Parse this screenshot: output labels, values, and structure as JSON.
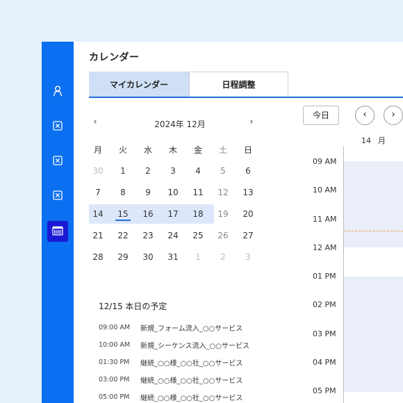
{
  "app": {
    "title": "カレンダー"
  },
  "sidebar": {
    "items": [
      {
        "name": "person-icon"
      },
      {
        "name": "close-box-icon"
      },
      {
        "name": "close-box-icon"
      },
      {
        "name": "close-box-icon"
      },
      {
        "name": "calendar-icon",
        "active": true
      }
    ],
    "accent": "#0a6ff0",
    "active_color": "#1a1ad6"
  },
  "tabs": [
    {
      "label": "マイカレンダー",
      "active": true
    },
    {
      "label": "日程調整",
      "active": false
    }
  ],
  "mini_calendar": {
    "prev": "‹",
    "next": "›",
    "month_label": "2024年 12月",
    "weekdays": [
      "月",
      "火",
      "水",
      "木",
      "金",
      "土",
      "日"
    ],
    "weeks": [
      [
        "30",
        "1",
        "2",
        "3",
        "4",
        "5",
        "6"
      ],
      [
        "7",
        "8",
        "9",
        "10",
        "11",
        "12",
        "13"
      ],
      [
        "14",
        "15",
        "16",
        "17",
        "18",
        "19",
        "20"
      ],
      [
        "21",
        "22",
        "23",
        "24",
        "25",
        "26",
        "27"
      ],
      [
        "28",
        "29",
        "30",
        "31",
        "1",
        "2",
        "3"
      ]
    ]
  },
  "agenda": {
    "title": "12/15 本日の予定",
    "events": [
      {
        "time": "09:00 AM",
        "title": "新規_フォーム流入_○○サービス"
      },
      {
        "time": "10:00 AM",
        "title": "新規_シーケンス流入_○○サービス"
      },
      {
        "time": "01:30 PM",
        "title": "継続_○○様_○○社_○○サービス"
      },
      {
        "time": "03:00 PM",
        "title": "継続_○○様_○○社_○○サービス"
      },
      {
        "time": "05:00 PM",
        "title": "継続_○○様_○○社_○○サービス"
      }
    ]
  },
  "week_view": {
    "today_label": "今日",
    "prev": "‹",
    "next": "›",
    "day_number": "14",
    "day_weekday": "月",
    "hours": [
      "09 AM",
      "10 AM",
      "11 AM",
      "12 AM",
      "01 PM",
      "02 PM",
      "03 PM",
      "04 PM",
      "05 PM"
    ]
  }
}
